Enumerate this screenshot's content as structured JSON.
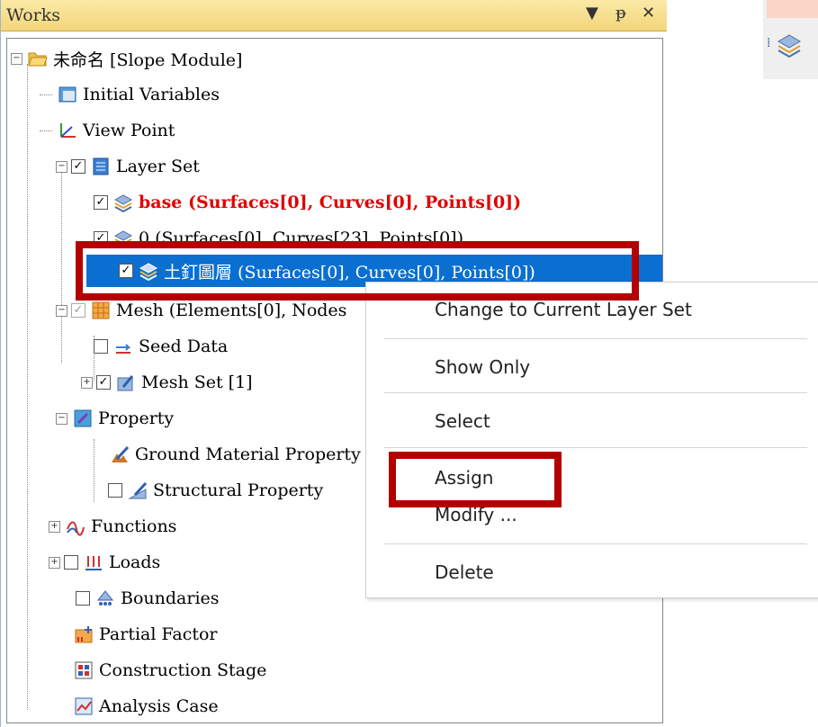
{
  "panel": {
    "title": "Works",
    "buttons": [
      "▼",
      "ᵽ",
      "✕"
    ]
  },
  "tree": {
    "root": "未命名 [Slope Module]",
    "initial_variables": "Initial Variables",
    "view_point": "View Point",
    "layer_set": "Layer Set",
    "layer_base": "base (Surfaces[0], Curves[0], Points[0])",
    "layer_0": "0 (Surfaces[0], Curves[23], Points[0])",
    "layer_nail": "土釘圖層 (Surfaces[0], Curves[0], Points[0])",
    "mesh": "Mesh (Elements[0], Nodes",
    "seed_data": "Seed Data",
    "mesh_set": "Mesh Set [1]",
    "property": "Property",
    "ground_material": "Ground Material Property",
    "structural_property": "Structural Property",
    "functions": "Functions",
    "loads": "Loads",
    "boundaries": "Boundaries",
    "partial_factor": "Partial Factor",
    "construction_stage": "Construction Stage",
    "analysis_case": "Analysis Case"
  },
  "context_menu": {
    "change_current": "Change to Current Layer Set",
    "show_only": "Show Only",
    "select": "Select",
    "assign": "Assign",
    "modify": "Modify ...",
    "delete": "Delete"
  },
  "colors": {
    "selection": "#0a6fd1",
    "highlight_box": "#b30000",
    "red_text": "#e00000",
    "titlebar": "#f4d67b"
  }
}
